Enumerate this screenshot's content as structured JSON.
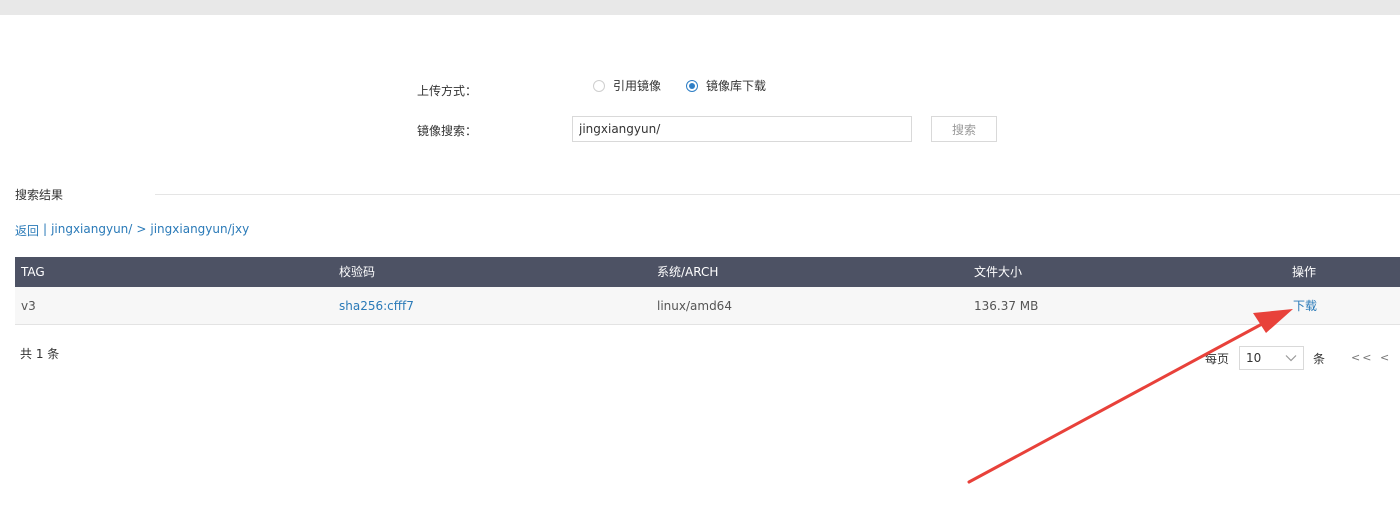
{
  "upload": {
    "label": "上传方式：",
    "options": [
      {
        "label": "引用镜像",
        "checked": false
      },
      {
        "label": "镜像库下载",
        "checked": true
      }
    ]
  },
  "search": {
    "label": "镜像搜索：",
    "value": "jingxiangyun/",
    "button": "搜索"
  },
  "results": {
    "title": "搜索结果",
    "breadcrumb": {
      "back": "返回",
      "sep": "|",
      "path1": "jingxiangyun/",
      "arrow": ">",
      "path2": "jingxiangyun/jxy"
    },
    "columns": [
      "TAG",
      "校验码",
      "系统/ARCH",
      "文件大小",
      "操作"
    ],
    "rows": [
      {
        "tag": "v3",
        "digest": "sha256:cfff7",
        "arch": "linux/amd64",
        "size": "136.37 MB",
        "action": "下载"
      }
    ]
  },
  "pagination": {
    "total": "共 1 条",
    "per_page_label": "每页",
    "per_page_value": "10",
    "unit": "条",
    "first": "<<",
    "prev": "<"
  },
  "colors": {
    "header_bg": "#4d5264",
    "link": "#2a7ab8",
    "annotation_arrow": "#e8413a"
  }
}
